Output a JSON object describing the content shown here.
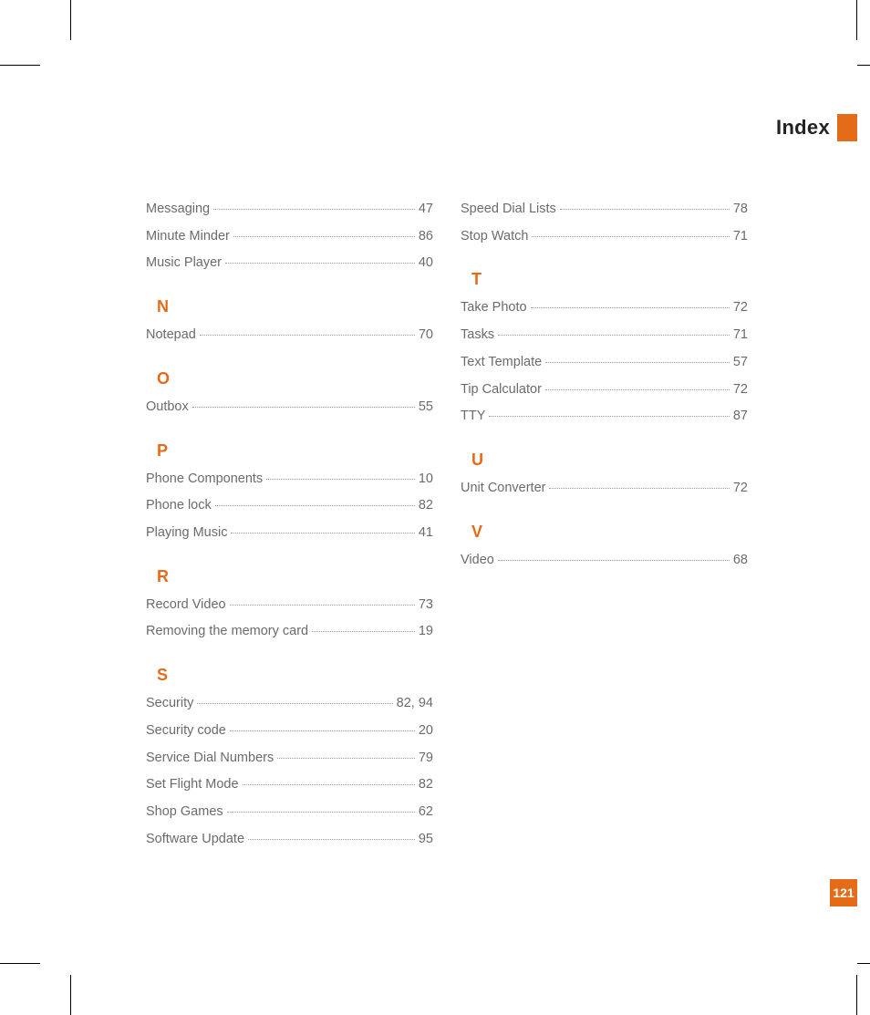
{
  "header": {
    "title": "Index"
  },
  "page_number": "121",
  "columns": [
    {
      "sections": [
        {
          "letter": "",
          "entries": [
            {
              "label": "Messaging",
              "pages": "47"
            },
            {
              "label": "Minute Minder",
              "pages": "86"
            },
            {
              "label": "Music Player",
              "pages": "40"
            }
          ]
        },
        {
          "letter": "N",
          "entries": [
            {
              "label": "Notepad",
              "pages": "70"
            }
          ]
        },
        {
          "letter": "O",
          "entries": [
            {
              "label": "Outbox",
              "pages": "55"
            }
          ]
        },
        {
          "letter": "P",
          "entries": [
            {
              "label": "Phone Components",
              "pages": "10"
            },
            {
              "label": "Phone lock",
              "pages": "82"
            },
            {
              "label": "Playing Music",
              "pages": "41"
            }
          ]
        },
        {
          "letter": "R",
          "entries": [
            {
              "label": "Record Video",
              "pages": "73"
            },
            {
              "label": "Removing the memory card",
              "pages": "19"
            }
          ]
        },
        {
          "letter": "S",
          "entries": [
            {
              "label": "Security",
              "pages": "82, 94"
            },
            {
              "label": "Security code",
              "pages": "20"
            },
            {
              "label": "Service Dial Numbers",
              "pages": "79"
            },
            {
              "label": "Set Flight Mode",
              "pages": "82"
            },
            {
              "label": "Shop Games",
              "pages": "62"
            },
            {
              "label": "Software Update",
              "pages": "95"
            }
          ]
        }
      ]
    },
    {
      "sections": [
        {
          "letter": "",
          "entries": [
            {
              "label": "Speed Dial Lists",
              "pages": "78"
            },
            {
              "label": "Stop Watch",
              "pages": "71"
            }
          ]
        },
        {
          "letter": "T",
          "entries": [
            {
              "label": "Take Photo",
              "pages": "72"
            },
            {
              "label": "Tasks",
              "pages": "71"
            },
            {
              "label": "Text Template",
              "pages": "57"
            },
            {
              "label": "Tip Calculator",
              "pages": "72"
            },
            {
              "label": "TTY",
              "pages": "87"
            }
          ]
        },
        {
          "letter": "U",
          "entries": [
            {
              "label": "Unit Converter",
              "pages": "72"
            }
          ]
        },
        {
          "letter": "V",
          "entries": [
            {
              "label": "Video",
              "pages": "68"
            }
          ]
        }
      ]
    }
  ]
}
